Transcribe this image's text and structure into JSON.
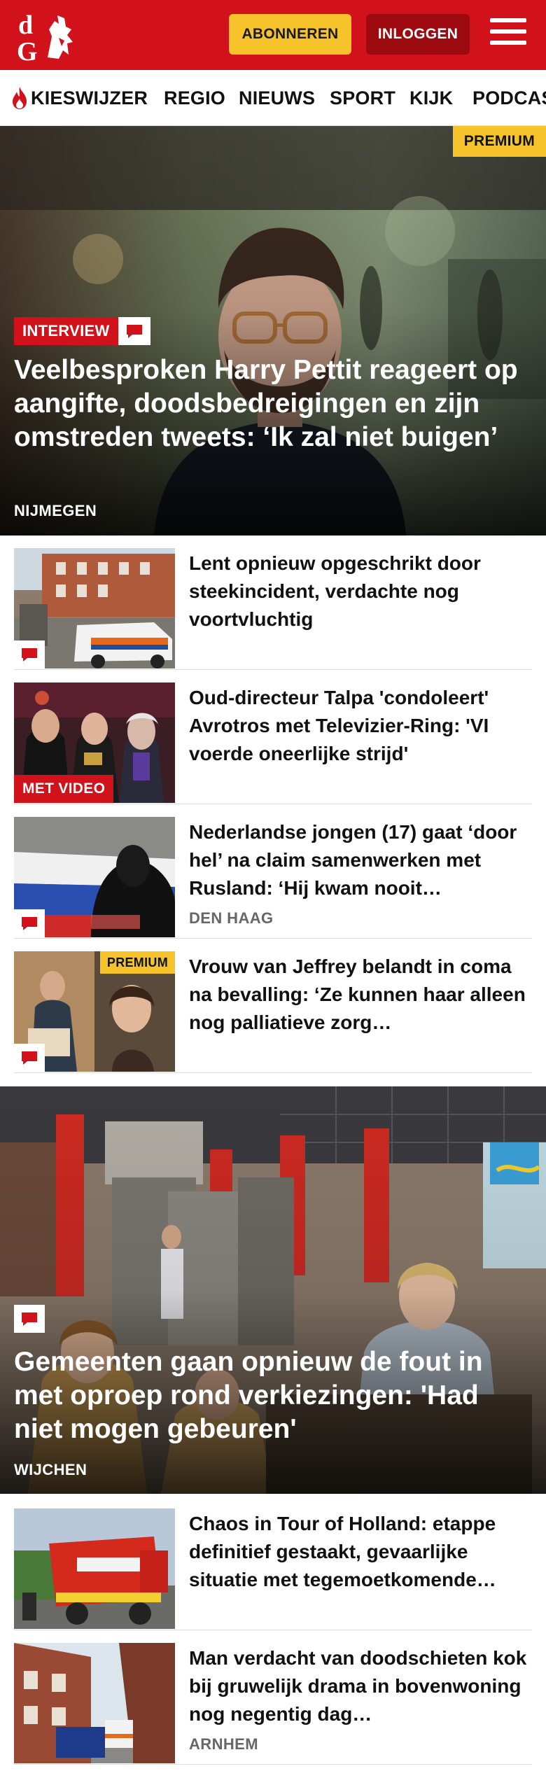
{
  "header": {
    "logo_text": "dG",
    "subscribe_label": "ABONNEREN",
    "login_label": "INLOGGEN",
    "menu_icon": "hamburger-icon"
  },
  "nav": {
    "items": [
      {
        "label": "KIESWIJZER",
        "icon": "flame-icon"
      },
      {
        "label": "REGIO"
      },
      {
        "label": "NIEUWS"
      },
      {
        "label": "SPORT"
      },
      {
        "label": "KIJK"
      },
      {
        "label": "PODCAS"
      }
    ]
  },
  "hero": {
    "premium_label": "PREMIUM",
    "tag": "INTERVIEW",
    "title": "Veelbesproken Harry Pettit reageert op aangifte, doodsbedreigingen en zijn omstreden tweets: ‘Ik zal niet buigen’",
    "location": "NIJMEGEN"
  },
  "articles": [
    {
      "title": "Lent opnieuw opgeschrikt door steekincident, verdachte nog voortvluchtig",
      "location": "",
      "badge": "comment"
    },
    {
      "title": "Oud-directeur Talpa 'condoleert' Avrotros met Televizier-Ring: 'VI voerde oneerlijke strijd'",
      "location": "",
      "badge": "MET VIDEO"
    },
    {
      "title": "Nederlandse jongen (17) gaat ‘door hel’ na claim samenwerken met Rusland: ‘Hij kwam nooit…",
      "location": "DEN HAAG",
      "badge": "comment"
    },
    {
      "title": "Vrouw van Jeffrey belandt in coma na bevalling: ‘Ze kunnen haar alleen nog palliatieve zorg…",
      "location": "",
      "badge": "comment",
      "premium": "PREMIUM"
    }
  ],
  "hero2": {
    "title": "Gemeenten gaan opnieuw de fout in met oproep rond verkiezingen: 'Had niet mogen gebeuren'",
    "location": "WIJCHEN"
  },
  "articles2": [
    {
      "title": "Chaos in Tour of Holland: etappe definitief gestaakt, gevaarlijke situatie met tegemoetkomende…",
      "location": ""
    },
    {
      "title": "Man verdacht van doodschieten kok bij gruwelijk drama in bovenwoning nog negentig dag…",
      "location": "ARNHEM"
    }
  ],
  "colors": {
    "brand_red": "#d2121a",
    "premium_yellow": "#f6c32b",
    "login_dark_red": "#9c0a10"
  }
}
